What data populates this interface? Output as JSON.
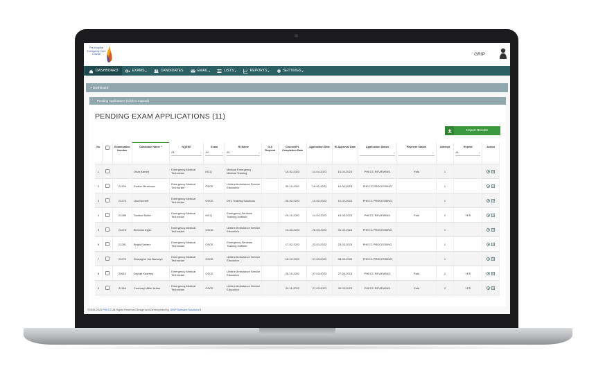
{
  "app": {
    "logo_lines": [
      "Pre-Hospital",
      "Emergency Care",
      "Council"
    ],
    "brand": "GRIP"
  },
  "nav": [
    {
      "label": "DASHBOARD",
      "icon": "home-icon",
      "active": true,
      "caret": false
    },
    {
      "label": "EXAMS",
      "icon": "key-icon",
      "active": false,
      "caret": true
    },
    {
      "label": "CANDIDATES",
      "icon": "users-icon",
      "active": false,
      "caret": false
    },
    {
      "label": "EMAIL",
      "icon": "envelope-icon",
      "active": false,
      "caret": true
    },
    {
      "label": "LISTS",
      "icon": "list-icon",
      "active": false,
      "caret": true
    },
    {
      "label": "REPORTS",
      "icon": "chart-icon",
      "active": false,
      "caret": true
    },
    {
      "label": "SETTINGS",
      "icon": "gear-icon",
      "active": false,
      "caret": true
    }
  ],
  "breadcrumb": "> Dashboard",
  "panel_header": "Pending Applications (Click to expand)",
  "page_title": "PENDING EXAM APPLICATIONS (11)",
  "import_button": "Import Results",
  "table": {
    "headers": {
      "no": "No",
      "exam_number": "Examination Number",
      "candidate_name": "Candidate Name",
      "nqemt": "NQEMT",
      "exam": "Exam",
      "ri_name": "RI Name",
      "ga_request": "G.A Request",
      "course_completion": "Course/IPL Completion Date",
      "application_date": "Application Date",
      "ri_approval": "RI Approval Date",
      "application_status": "Application Status",
      "payment_status": "Payment Status",
      "attempt": "Attempt",
      "repeat": "Repeat",
      "action": "Action"
    },
    "filters": {
      "all": "All"
    },
    "rows": [
      {
        "no": "1",
        "exam_number": "",
        "candidate": "Oisin Barrett",
        "nqemt": "Emergency Medical Technician",
        "exam": "MCQ",
        "ri": "Medical Emergency Medical Training",
        "completion": "15-02-2023",
        "app_date": "14-04-2023",
        "ri_date": "14-04-2023",
        "status": "PHECC REVIEWING",
        "payment": "Paid",
        "attempt": "1",
        "repeat": ""
      },
      {
        "no": "2",
        "exam_number": "21134",
        "candidate": "Rodion Bezsonov",
        "nqemt": "Emergency Medical Technician",
        "exam": "OSCE",
        "ri": "Lifeline Ambulance Service Education",
        "completion": "30-10-2022",
        "app_date": "16-02-2023",
        "ri_date": "16-02-2023",
        "status": "PHECC PROCESSING",
        "payment": "",
        "attempt": "1",
        "repeat": ""
      },
      {
        "no": "3",
        "exam_number": "21273",
        "candidate": "Lisa Burnett",
        "nqemt": "Emergency Medical Technician",
        "exam": "OSCE",
        "ri": "DX2 Training Solutions",
        "completion": "06-02-2023",
        "app_date": "10-02-2023",
        "ri_date": "10-02-2023",
        "status": "PHECC PROCESSING",
        "payment": "",
        "attempt": "1",
        "repeat": ""
      },
      {
        "no": "4",
        "exam_number": "21285",
        "candidate": "Saoirse Butler",
        "nqemt": "Emergency Medical Technician",
        "exam": "MCQ",
        "ri": "Emergency Services Training Institute",
        "completion": "29-10-2022",
        "app_date": "14-04-2023",
        "ri_date": "14-04-2023",
        "status": "PHECC REVIEWING",
        "payment": "Paid",
        "attempt": "2",
        "repeat": "YES"
      },
      {
        "no": "5",
        "exam_number": "21275",
        "candidate": "Brendan Egan",
        "nqemt": "Emergency Medical Technician",
        "exam": "OSCE",
        "ri": "Lifeline Ambulance Service Education",
        "completion": "10-03-2023",
        "app_date": "28-03-2023",
        "ri_date": "31-03-2023",
        "status": "PHECC PROCESSING",
        "payment": "",
        "attempt": "1",
        "repeat": ""
      },
      {
        "no": "6",
        "exam_number": "21281",
        "candidate": "Brigid Flaherx",
        "nqemt": "Emergency Medical Technician",
        "exam": "OSCE",
        "ri": "Emergency Services Training Institute",
        "completion": "17-02-2023",
        "app_date": "23-03-2023",
        "ri_date": "23-03-2023",
        "status": "PHECC PROCESSING",
        "payment": "",
        "attempt": "1",
        "repeat": ""
      },
      {
        "no": "7",
        "exam_number": "21279",
        "candidate": "Edosaghe Jos Bazuaye",
        "nqemt": "Emergency Medical Technician",
        "exam": "OSCE",
        "ri": "Lifeline Ambulance Service Education",
        "completion": "15-12-2022",
        "app_date": "07-03-2023",
        "ri_date": "08-03-2023",
        "status": "PHECC PROCESSING",
        "payment": "",
        "attempt": "1",
        "repeat": ""
      },
      {
        "no": "8",
        "exam_number": "20610",
        "candidate": "Declan Kearney",
        "nqemt": "Emergency Medical Technician",
        "exam": "OSCE",
        "ri": "Lifeline Ambulance Service Education",
        "completion": "28-10-2022",
        "app_date": "27-03-2023",
        "ri_date": "27-03-2023",
        "status": "PHECC REVIEWING",
        "payment": "Paid",
        "attempt": "2",
        "repeat": "YES"
      },
      {
        "no": "9",
        "exam_number": "21146",
        "candidate": "Courtney Miller Arthur",
        "nqemt": "Emergency Medical Technician",
        "exam": "OSCE",
        "ri": "Lifeline Ambulance Service Education",
        "completion": "24-11-2022",
        "app_date": "27-03-2023",
        "ri_date": "30-03-2023",
        "status": "PHECC REVIEWING",
        "payment": "Paid",
        "attempt": "2",
        "repeat": "YES"
      }
    ]
  },
  "footer": {
    "prefix": "©2020-2023 ",
    "link1": "PHECC",
    "middle": " All Rights Reserved Design and Development by ",
    "link2": "GRIP Software Solutions",
    "suffix": "  ℹ"
  },
  "colors": {
    "navbar": "#2b5f63",
    "panel": "#8fa7ad",
    "import": "#3b9a3e"
  }
}
